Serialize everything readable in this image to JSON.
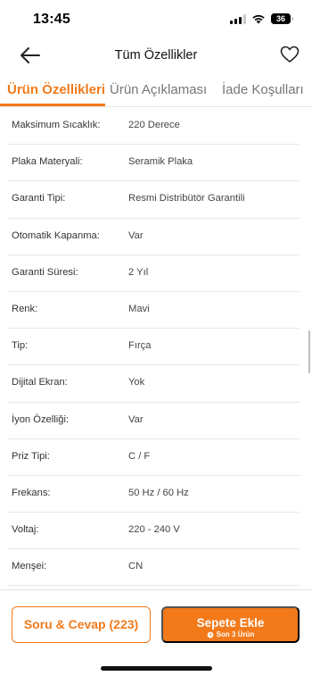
{
  "status_bar": {
    "time": "13:45",
    "battery": "36"
  },
  "nav": {
    "title": "Tüm Özellikler"
  },
  "tabs": [
    {
      "label": "Ürün Özellikleri",
      "active": true
    },
    {
      "label": "Ürün Açıklaması",
      "active": false
    },
    {
      "label": "İade Koşulları",
      "active": false
    }
  ],
  "specs": [
    {
      "label": "Maksimum Sıcaklık:",
      "value": "220 Derece"
    },
    {
      "label": "Plaka Materyali:",
      "value": "Seramik Plaka"
    },
    {
      "label": "Garanti Tipi:",
      "value": "Resmi Distribütör Garantili"
    },
    {
      "label": "Otomatik Kapanma:",
      "value": "Var"
    },
    {
      "label": "Garanti Süresi:",
      "value": "2 Yıl"
    },
    {
      "label": "Renk:",
      "value": "Mavi"
    },
    {
      "label": "Tip:",
      "value": "Fırça"
    },
    {
      "label": "Dijital Ekran:",
      "value": "Yok"
    },
    {
      "label": "İyon Özelliği:",
      "value": "Var"
    },
    {
      "label": "Priz Tipi:",
      "value": "C / F"
    },
    {
      "label": "Frekans:",
      "value": "50 Hz / 60 Hz"
    },
    {
      "label": "Voltaj:",
      "value": "220 - 240 V"
    },
    {
      "label": "Menşei:",
      "value": "CN"
    }
  ],
  "bottom": {
    "qa_label": "Soru & Cevap (223)",
    "cart_label": "Sepete Ekle",
    "cart_sub": "Son 3 Ürün"
  },
  "colors": {
    "accent": "#f27a1a"
  },
  "icons": {
    "back": "arrow-left-icon",
    "favorite": "heart-icon",
    "stock": "clock-icon"
  }
}
